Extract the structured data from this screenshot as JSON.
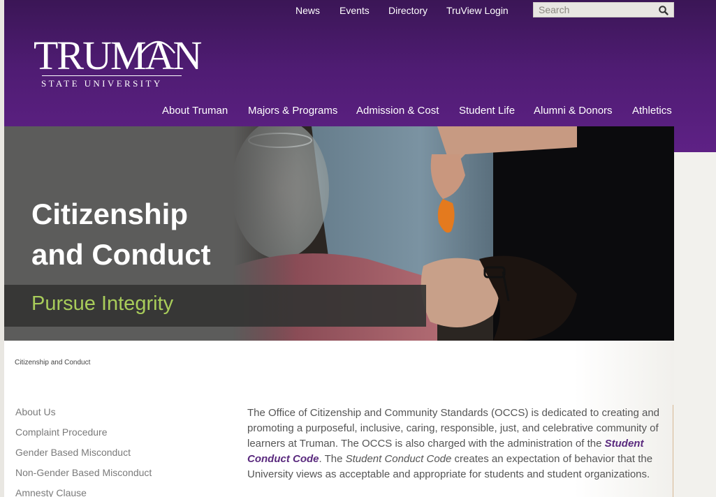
{
  "utility_nav": {
    "items": [
      "News",
      "Events",
      "Directory",
      "TruView Login"
    ],
    "search_placeholder": "Search"
  },
  "logo": {
    "wordmark": "TRUMAN",
    "subtitle": "STATE UNIVERSITY"
  },
  "main_nav": {
    "items": [
      "About Truman",
      "Majors & Programs",
      "Admission & Cost",
      "Student Life",
      "Alumni & Donors",
      "Athletics"
    ]
  },
  "hero": {
    "title_line1": "Citizenship",
    "title_line2": "and Conduct",
    "subtitle": "Pursue Integrity"
  },
  "breadcrumb": "Citizenship and Conduct",
  "side_nav": {
    "items": [
      "About Us",
      "Complaint Procedure",
      "Gender Based Misconduct",
      "Non-Gender Based Misconduct",
      "Amnesty Clause"
    ]
  },
  "content": {
    "p1_a": "The Office of Citizenship and Community Standards (OCCS) is dedicated to creating and promoting a purposeful, inclusive, caring, responsible, just, and celebrative community of learners at Truman.  The OCCS is also charged with the administration of the ",
    "p1_link": "Student Conduct Code",
    "p1_b": ".  The ",
    "p1_em": "Student Conduct Code",
    "p1_c": " creates an expectation of behavior that the University views as acceptable and appropriate for students and student organizations."
  },
  "colors": {
    "header_purple": "#4f1c73",
    "accent_green": "#a8cc5a",
    "link_purple": "#5a2a7e"
  }
}
